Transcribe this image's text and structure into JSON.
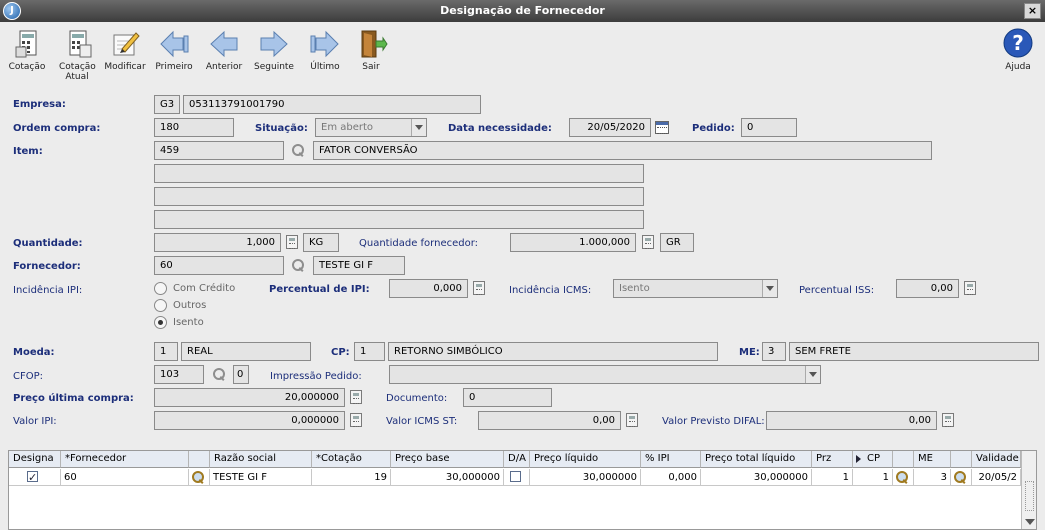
{
  "window": {
    "title": "Designação de Fornecedor",
    "close": "×"
  },
  "toolbar": {
    "cotacao": "Cotação",
    "cotacao_atual": "Cotação Atual",
    "modificar": "Modificar",
    "primeiro": "Primeiro",
    "anterior": "Anterior",
    "seguinte": "Seguinte",
    "ultimo": "Último",
    "sair": "Sair",
    "ajuda": "Ajuda"
  },
  "form": {
    "empresa_label": "Empresa:",
    "empresa_code": "G3",
    "empresa_cnpj": "053113791001790",
    "ordem_label": "Ordem compra:",
    "ordem_value": "180",
    "situacao_label": "Situação:",
    "situacao_value": "Em aberto",
    "data_label": "Data necessidade:",
    "data_value": "20/05/2020",
    "pedido_label": "Pedido:",
    "pedido_value": "0",
    "item_label": "Item:",
    "item_code": "459",
    "item_desc": "FATOR CONVERSÃO",
    "quantidade_label": "Quantidade:",
    "quantidade_value": "1,000",
    "quantidade_unit": "KG",
    "qtd_forn_label": "Quantidade fornecedor:",
    "qtd_forn_value": "1.000,000",
    "qtd_forn_unit": "GR",
    "fornecedor_label": "Fornecedor:",
    "fornecedor_code": "60",
    "fornecedor_name": "TESTE GI F",
    "ipi_label": "Incidência IPI:",
    "ipi_options": [
      "Com Crédito",
      "Outros",
      "Isento"
    ],
    "ipi_selected": "Isento",
    "perc_ipi_label": "Percentual de IPI:",
    "perc_ipi_value": "0,000",
    "icms_label": "Incidência ICMS:",
    "icms_value": "Isento",
    "iss_label": "Percentual ISS:",
    "iss_value": "0,00",
    "moeda_label": "Moeda:",
    "moeda_code": "1",
    "moeda_name": "REAL",
    "cp_label": "CP:",
    "cp_code": "1",
    "cp_name": "RETORNO SIMBÓLICO",
    "me_label": "ME:",
    "me_code": "3",
    "me_name": "SEM FRETE",
    "cfop_label": "CFOP:",
    "cfop_value": "103",
    "cfop_seq": "0",
    "impressao_label": "Impressão Pedido:",
    "impressao_value": "",
    "preco_label": "Preço última compra:",
    "preco_value": "20,000000",
    "documento_label": "Documento:",
    "documento_value": "0",
    "valor_ipi_label": "Valor IPI:",
    "valor_ipi_value": "0,000000",
    "valor_icms_st_label": "Valor ICMS ST:",
    "valor_icms_st_value": "0,00",
    "difal_label": "Valor Previsto DIFAL:",
    "difal_value": "0,00"
  },
  "grid": {
    "headers": [
      "Designa",
      "*Fornecedor",
      "",
      "Razão social",
      "*Cotação",
      "Preço base",
      "D/A",
      "Preço líquido",
      "% IPI",
      "Preço total líquido",
      "Prz",
      "CP",
      "",
      "ME",
      "",
      "Validade"
    ],
    "rows": [
      {
        "designa": true,
        "fornecedor": "60",
        "razao": "TESTE GI F",
        "cotacao": "19",
        "preco_base": "30,000000",
        "da": false,
        "preco_liquido": "30,000000",
        "ipi": "0,000",
        "preco_total": "30,000000",
        "prz": "1",
        "cp": "1",
        "me": "3",
        "validade": "20/05/2"
      }
    ]
  }
}
